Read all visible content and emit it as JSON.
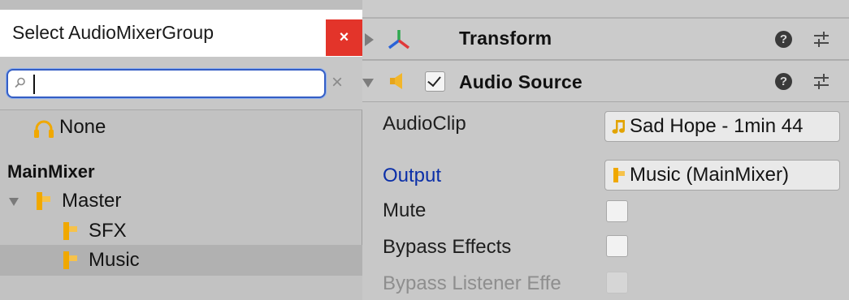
{
  "inspector": {
    "components": [
      {
        "title": "Transform",
        "expanded": false,
        "icon": "transform-axes-icon"
      },
      {
        "title": "Audio Source",
        "expanded": true,
        "enabled": true,
        "icon": "speaker-icon"
      }
    ],
    "properties": {
      "audioclip": {
        "label": "AudioClip",
        "value": "Sad Hope - 1min 44",
        "icon": "music-note-icon"
      },
      "output": {
        "label": "Output",
        "value": "Music (MainMixer)",
        "icon": "mixer-group-icon"
      },
      "mute": {
        "label": "Mute",
        "checked": false
      },
      "bypass_effects": {
        "label": "Bypass Effects",
        "checked": false
      },
      "bypass_listener": {
        "label": "Bypass Listener Effe",
        "checked": false,
        "disabled": true
      }
    }
  },
  "popup": {
    "title": "Select AudioMixerGroup",
    "close_label": "×",
    "search": {
      "value": "",
      "placeholder": ""
    },
    "clear_label": "×",
    "none_label": "None",
    "mixer_name": "MainMixer",
    "groups": [
      {
        "label": "Master",
        "level": 0,
        "expanded": true,
        "selected": false
      },
      {
        "label": "SFX",
        "level": 1,
        "selected": false
      },
      {
        "label": "Music",
        "level": 1,
        "selected": true
      }
    ]
  },
  "colors": {
    "close_button": "#e3342a",
    "search_focus": "#355ec4",
    "mixer_icon": "#f0a800",
    "output_label": "#0b2fa8",
    "selected_row": "#b1b1b1"
  }
}
